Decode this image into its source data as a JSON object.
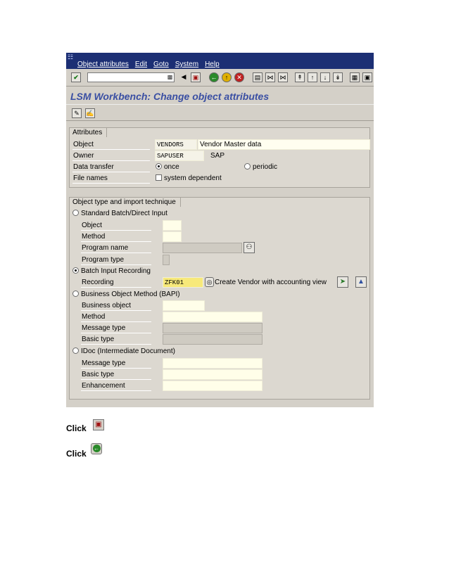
{
  "menubar": {
    "items": [
      "Object attributes",
      "Edit",
      "Goto",
      "System",
      "Help"
    ]
  },
  "toolbar": {
    "command_value": ""
  },
  "page_title": "LSM Workbench: Change object attributes",
  "attributes": {
    "group_label": "Attributes",
    "object_label": "Object",
    "object_value": "VENDORS",
    "object_desc": "Vendor Master data",
    "owner_label": "Owner",
    "owner_value": "SAPUSER",
    "owner_desc": "SAP",
    "data_transfer_label": "Data transfer",
    "once_label": "once",
    "periodic_label": "periodic",
    "file_names_label": "File names",
    "system_dependent_label": "system dependent"
  },
  "import": {
    "group_label": "Object type and import technique",
    "standard_batch_label": "Standard Batch/Direct Input",
    "sb_object_label": "Object",
    "sb_method_label": "Method",
    "sb_program_name_label": "Program name",
    "sb_program_type_label": "Program type",
    "batch_input_label": "Batch Input Recording",
    "recording_label": "Recording",
    "recording_value": "ZFK01",
    "recording_desc": "Create Vendor with accounting view",
    "bapi_label": "Business Object Method (BAPI)",
    "bapi_object_label": "Business object",
    "bapi_method_label": "Method",
    "bapi_message_type_label": "Message type",
    "bapi_basic_type_label": "Basic type",
    "idoc_label": "IDoc (Intermediate Document)",
    "idoc_message_type_label": "Message type",
    "idoc_basic_type_label": "Basic type",
    "idoc_enhancement_label": "Enhancement"
  },
  "instructions": {
    "click1": "Click",
    "click2": "Click"
  }
}
